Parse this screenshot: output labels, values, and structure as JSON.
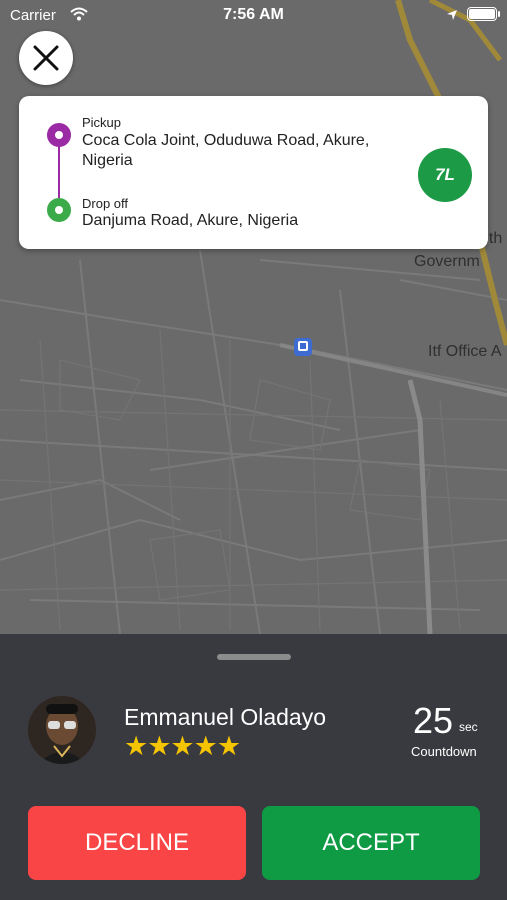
{
  "status_bar": {
    "carrier": "Carrier",
    "time": "7:56 AM"
  },
  "map": {
    "labels": [
      "uth",
      "Governm",
      "Itf Office A"
    ]
  },
  "route": {
    "pickup_label": "Pickup",
    "pickup_address": "Coca Cola Joint, Oduduwa Road, Akure, Nigeria",
    "dropoff_label": "Drop off",
    "dropoff_address": "Danjuma Road, Akure, Nigeria",
    "brand_badge": "7L"
  },
  "driver": {
    "name": "Emmanuel Oladayo",
    "rating_stars": "★★★★★",
    "rating_value": 5
  },
  "countdown": {
    "value": "25",
    "unit": "sec",
    "label": "Countdown"
  },
  "actions": {
    "decline": "DECLINE",
    "accept": "ACCEPT"
  },
  "colors": {
    "pickup": "#9b2aa5",
    "dropoff": "#3bab4a",
    "decline": "#f94545",
    "accept": "#0f9a44",
    "star": "#f5c400",
    "sheet": "#393940"
  }
}
